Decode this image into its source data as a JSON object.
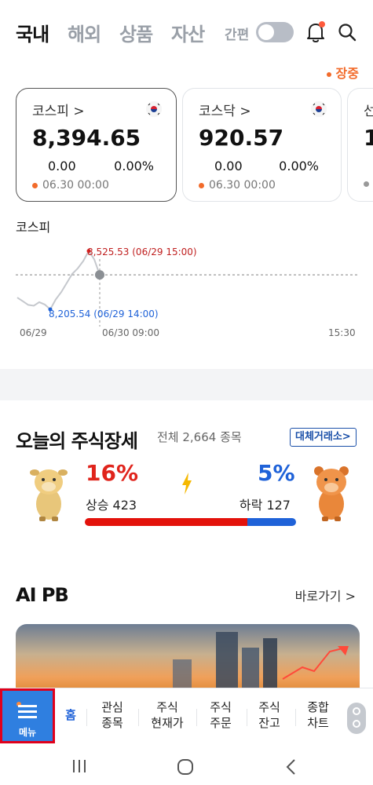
{
  "header": {
    "tabs": [
      {
        "label": "국내",
        "active": true
      },
      {
        "label": "해외",
        "active": false
      },
      {
        "label": "상품",
        "active": false
      },
      {
        "label": "자산",
        "active": false
      }
    ],
    "simple_mode_label": "간편",
    "simple_mode_on": false
  },
  "market_status": "장중",
  "index_cards": [
    {
      "name": "코스피 >",
      "price": "8,394.65",
      "change": "0.00",
      "percent": "0.00%",
      "time": "06.30 00:00"
    },
    {
      "name": "코스닥 >",
      "price": "920.57",
      "change": "0.00",
      "percent": "0.00%",
      "time": "06.30 00:00"
    },
    {
      "name": "선",
      "price": "1"
    }
  ],
  "chart": {
    "title": "코스피",
    "high_label": "8,525.53 (06/29 15:00)",
    "low_label": "8,205.54 (06/29 14:00)",
    "x_labels": [
      "06/29",
      "06/30 09:00",
      "15:30"
    ]
  },
  "chart_data": {
    "type": "line",
    "title": "코스피",
    "x": [
      "06/29",
      "",
      "",
      "",
      "",
      "",
      "",
      "",
      "",
      "",
      "",
      "",
      "",
      "",
      "",
      "06/30 09:00"
    ],
    "series": [
      {
        "values": [
          8270,
          8250,
          8230,
          8225,
          8245,
          8232,
          8205.54,
          8260,
          8300,
          8350,
          8400,
          8430,
          8470,
          8525.53,
          8480,
          8394.65
        ]
      }
    ],
    "reference_value": 8394.65,
    "xlabel": "",
    "ylabel": "",
    "ylim": [
      8180,
      8550
    ],
    "grid": false
  },
  "overview": {
    "title": "오늘의 주식장세",
    "total_label": "전체 2,664 종목",
    "exchange_button": "대체거래소>",
    "up_percent": "16%",
    "down_percent": "5%",
    "up_label": "상승 423",
    "down_label": "하락 127",
    "up_ratio": 0.77
  },
  "ai_pb": {
    "title": "AI PB",
    "goto_label": "바로가기 >"
  },
  "bottom_nav": {
    "menu_label": "메뉴",
    "items": [
      {
        "label": "홈",
        "active": true
      },
      {
        "label": "관심\n종목"
      },
      {
        "label": "주식\n현재가"
      },
      {
        "label": "주식\n주문"
      },
      {
        "label": "주식\n잔고"
      },
      {
        "label": "종합\n차트"
      }
    ]
  },
  "colors": {
    "accent_orange": "#f26b2b",
    "up_red": "#e3120b",
    "down_blue": "#1f62d8",
    "menu_blue": "#2f7fe0"
  }
}
